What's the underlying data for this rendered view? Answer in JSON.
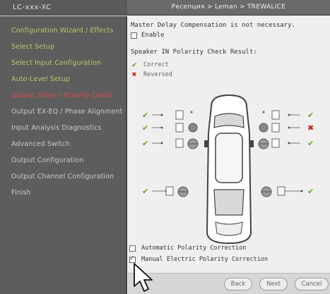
{
  "window": {
    "app_title": "LC-xxx-XC",
    "step_title": "Ресепция > Leman > TREWALICE"
  },
  "sidebar": {
    "items": [
      {
        "label": "Configuration Wizard / Effects",
        "state": "done"
      },
      {
        "label": "Select Setup",
        "state": "done"
      },
      {
        "label": "Select Input Configuration",
        "state": "done"
      },
      {
        "label": "Auto-Level Setup",
        "state": "done"
      },
      {
        "label": "Output Delay / Polarity Check",
        "state": "current"
      },
      {
        "label": "Output EX-EQ / Phase Alignment",
        "state": "todo"
      },
      {
        "label": "Input Analysis Diagnostics",
        "state": "todo"
      },
      {
        "label": "Advanced Switch",
        "state": "todo"
      },
      {
        "label": "Output Configuration",
        "state": "todo"
      },
      {
        "label": "Output Channel Configuration",
        "state": "todo"
      },
      {
        "label": "Finish",
        "state": "todo"
      }
    ]
  },
  "main": {
    "notice": "Master Delay Compensation is not necessary.",
    "enable_label": "Enable",
    "result_title": "Speaker IN Polarity Check Result:",
    "legend": {
      "correct_label": "Correct",
      "reversed_label": "Reversed"
    },
    "speakers": {
      "left": [
        "1",
        "2",
        "3",
        "4"
      ],
      "right": [
        "5",
        "6",
        "7",
        "8"
      ],
      "status_right": [
        "correct",
        "reversed",
        "correct",
        "correct"
      ],
      "status_left": [
        "correct",
        "correct",
        "correct",
        "correct"
      ]
    },
    "options": {
      "automatic_label": "Automatic Polarity Correction",
      "manual_label": "Manual Electric Polarity Correction",
      "automatic_checked": false,
      "manual_checked": true
    }
  },
  "buttons": {
    "back": "Back",
    "next": "Next",
    "cancel": "Cancel"
  },
  "colors": {
    "correct": "#5aa71f",
    "reversed": "#c62020",
    "current_step": "#d84c4c",
    "done_step": "#b7c86b"
  }
}
